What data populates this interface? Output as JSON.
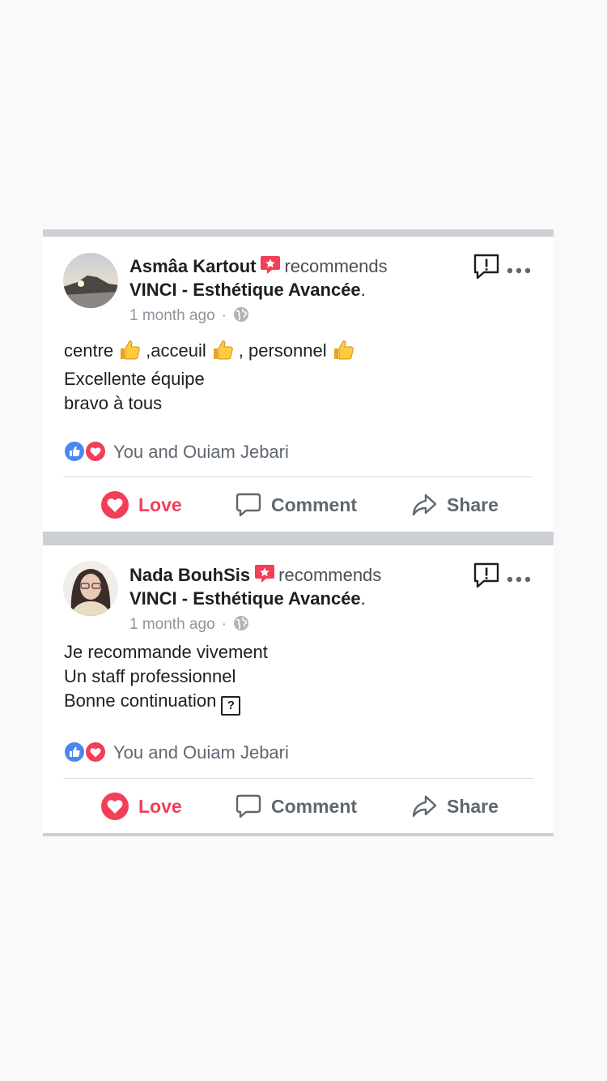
{
  "posts": [
    {
      "author": "Asmâa Kartout",
      "verb": "recommends",
      "page_name": "VINCI - Esthétique Avancée",
      "page_suffix": ".",
      "time": "1 month ago",
      "separator": "·",
      "body": {
        "word1": "centre",
        "word2": ",acceuil",
        "word3": ", personnel",
        "line2": "Excellente équipe",
        "line3": "bravo à tous"
      },
      "reactions_text": "You and Ouiam Jebari"
    },
    {
      "author": "Nada BouhSis",
      "verb": "recommends",
      "page_name": "VINCI - Esthétique Avancée",
      "page_suffix": ".",
      "time": "1 month ago",
      "separator": "·",
      "body": {
        "line1": "Je recommande vivement",
        "line2": "Un staff professionnel",
        "line3": "Bonne continuation",
        "unknown_glyph": "?"
      },
      "reactions_text": "You and Ouiam Jebari"
    }
  ],
  "actions": {
    "love": "Love",
    "comment": "Comment",
    "share": "Share"
  },
  "icons": {
    "recommend": "recommend-star-icon",
    "report": "report-icon",
    "more": "more-options-icon",
    "privacy": "globe-icon",
    "like": "like-reaction-icon",
    "love": "love-reaction-icon"
  },
  "colors": {
    "love": "#f33e58",
    "like": "#4a88f0",
    "text": "#1c1e21",
    "meta": "#90949c",
    "action": "#606770",
    "feed_gap": "#ccd0d5"
  }
}
